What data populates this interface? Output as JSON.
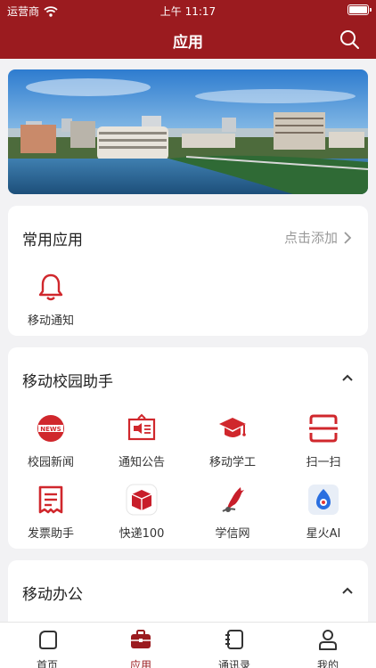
{
  "status": {
    "carrier": "运营商",
    "time": "上午 11:17"
  },
  "nav": {
    "title": "应用"
  },
  "common_apps": {
    "title": "常用应用",
    "action": "点击添加",
    "items": [
      {
        "label": "移动通知",
        "icon": "bell-icon"
      }
    ]
  },
  "campus": {
    "title": "移动校园助手",
    "items": [
      {
        "label": "校园新闻",
        "icon": "news-icon"
      },
      {
        "label": "通知公告",
        "icon": "announcement-icon"
      },
      {
        "label": "移动学工",
        "icon": "graduation-cap-icon"
      },
      {
        "label": "扫一扫",
        "icon": "scan-icon"
      },
      {
        "label": "发票助手",
        "icon": "invoice-icon"
      },
      {
        "label": "快递100",
        "icon": "package-icon"
      },
      {
        "label": "学信网",
        "icon": "bird-logo-icon"
      },
      {
        "label": "星火AI",
        "icon": "spark-ai-icon"
      }
    ]
  },
  "office": {
    "title": "移动办公"
  },
  "tabs": [
    {
      "label": "首页",
      "icon": "home-icon"
    },
    {
      "label": "应用",
      "icon": "briefcase-icon",
      "active": true
    },
    {
      "label": "通讯录",
      "icon": "contacts-icon"
    },
    {
      "label": "我的",
      "icon": "profile-icon"
    }
  ],
  "colors": {
    "brand": "#9b1b1f",
    "accent": "#d0272c"
  }
}
